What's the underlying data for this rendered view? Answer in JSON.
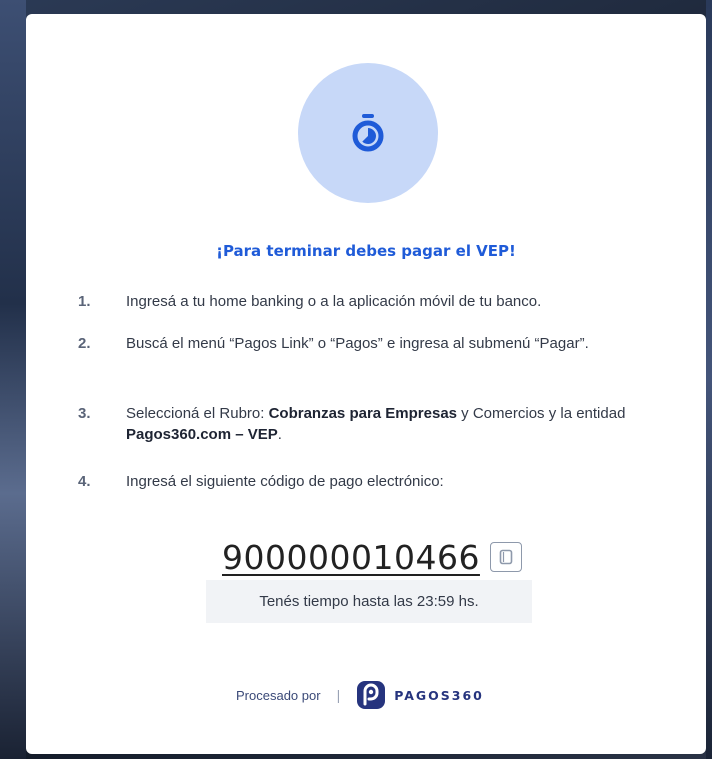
{
  "dialog": {
    "title": "¡Para terminar debes pagar el VEP!",
    "steps": [
      {
        "number": "1.",
        "text": "Ingresá a tu home banking o a la aplicación móvil de tu banco."
      },
      {
        "number": "2.",
        "text": "Buscá el menú “Pagos Link” o “Pagos” e ingresa al submenú “Pagar”."
      },
      {
        "number": "3.",
        "text_a": "Seleccioná el Rubro: ",
        "bold_a": "Cobranzas para Empresas",
        "text_b": " y Comercios y la entidad ",
        "bold_b": "Pagos360.com – VEP",
        "text_c": "."
      },
      {
        "number": "4.",
        "text": "Ingresá el siguiente código de pago electrónico:"
      }
    ],
    "payment_code": "900000010466",
    "deadline": "Tenés tiempo hasta las 23:59 hs.",
    "footer": {
      "processed_by": "Procesado por",
      "separator": "|",
      "brand": "PAGOS360"
    }
  },
  "colors": {
    "accent": "#1f5bd8",
    "timer_circle": "#c7d8f8",
    "brand": "#26347e"
  },
  "icons": {
    "timer": "stopwatch-icon",
    "copy": "copy-icon",
    "logo": "pagos360-logo-icon"
  }
}
